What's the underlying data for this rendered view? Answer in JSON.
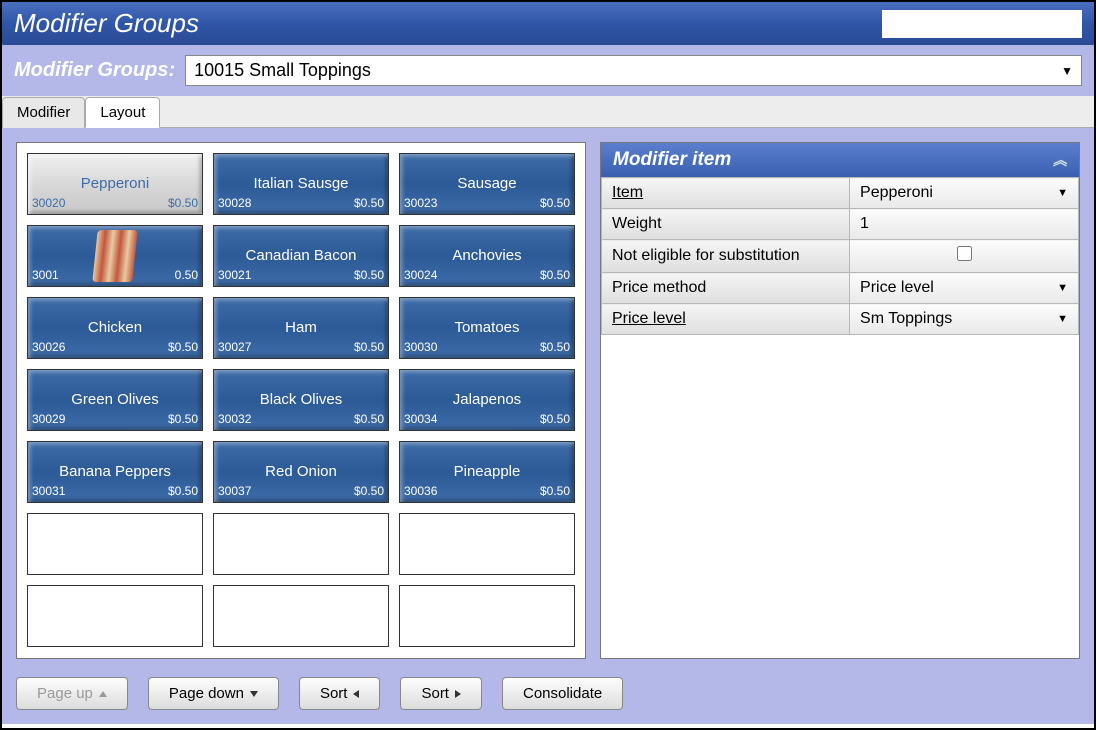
{
  "window": {
    "title": "Modifier Groups"
  },
  "subbar": {
    "label": "Modifier Groups:",
    "selected": "10015 Small Toppings"
  },
  "tabs": [
    {
      "label": "Modifier",
      "active": false
    },
    {
      "label": "Layout",
      "active": true
    }
  ],
  "grid": {
    "slots": [
      {
        "code": "30020",
        "name": "Pepperoni",
        "price": "$0.50",
        "selected": true
      },
      {
        "code": "30028",
        "name": "Italian Sausge",
        "price": "$0.50"
      },
      {
        "code": "30023",
        "name": "Sausage",
        "price": "$0.50"
      },
      {
        "code": "3001",
        "name": "",
        "price": "0.50",
        "image": "bacon"
      },
      {
        "code": "30021",
        "name": "Canadian Bacon",
        "price": "$0.50"
      },
      {
        "code": "30024",
        "name": "Anchovies",
        "price": "$0.50"
      },
      {
        "code": "30026",
        "name": "Chicken",
        "price": "$0.50"
      },
      {
        "code": "30027",
        "name": "Ham",
        "price": "$0.50"
      },
      {
        "code": "30030",
        "name": "Tomatoes",
        "price": "$0.50"
      },
      {
        "code": "30029",
        "name": "Green Olives",
        "price": "$0.50"
      },
      {
        "code": "30032",
        "name": "Black Olives",
        "price": "$0.50"
      },
      {
        "code": "30034",
        "name": "Jalapenos",
        "price": "$0.50"
      },
      {
        "code": "30031",
        "name": "Banana Peppers",
        "price": "$0.50"
      },
      {
        "code": "30037",
        "name": "Red Onion",
        "price": "$0.50"
      },
      {
        "code": "30036",
        "name": "Pineapple",
        "price": "$0.50"
      },
      {
        "empty": true
      },
      {
        "empty": true
      },
      {
        "empty": true
      },
      {
        "empty": true
      },
      {
        "empty": true
      },
      {
        "empty": true
      }
    ]
  },
  "side": {
    "title": "Modifier item",
    "rows": {
      "item_label": "Item",
      "item_value": "Pepperoni",
      "weight_label": "Weight",
      "weight_value": "1",
      "sub_label": "Not eligible for substitution",
      "sub_checked": false,
      "pm_label": "Price method",
      "pm_value": "Price level",
      "pl_label": "Price level",
      "pl_value": "Sm Toppings"
    }
  },
  "buttons": {
    "pageup": "Page up",
    "pagedown": "Page down",
    "sortleft": "Sort",
    "sortright": "Sort",
    "consolidate": "Consolidate"
  }
}
